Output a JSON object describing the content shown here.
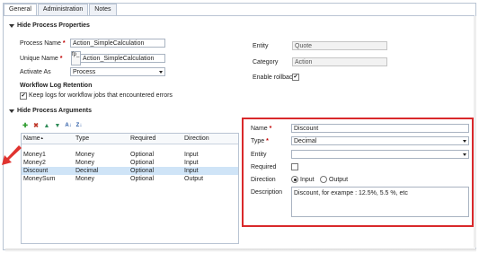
{
  "tabs": [
    "General",
    "Administration",
    "Notes"
  ],
  "process": {
    "section_title": "Hide Process Properties",
    "process_name_label": "Process Name",
    "process_name_value": "Action_SimpleCalculation",
    "unique_name_label": "Unique Name",
    "unique_name_prefix": "fp_",
    "unique_name_value": "Action_SimpleCalculation",
    "activate_as_label": "Activate As",
    "activate_as_value": "Process",
    "entity_label": "Entity",
    "entity_value": "Quote",
    "category_label": "Category",
    "category_value": "Action",
    "rollback_label": "Enable rollback",
    "rollback_checked": true,
    "log_title": "Workflow Log Retention",
    "log_label": "Keep logs for workflow jobs that encountered errors",
    "log_checked": true
  },
  "arguments": {
    "section_title": "Hide Process Arguments",
    "columns": [
      "Name",
      "Type",
      "Required",
      "Direction"
    ],
    "sort_indicator": "▲",
    "rows": [
      {
        "name": "Money1",
        "type": "Money",
        "required": "Optional",
        "direction": "Input"
      },
      {
        "name": "Money2",
        "type": "Money",
        "required": "Optional",
        "direction": "Input"
      },
      {
        "name": "Discount",
        "type": "Decimal",
        "required": "Optional",
        "direction": "Input"
      },
      {
        "name": "MoneySum",
        "type": "Money",
        "required": "Optional",
        "direction": "Output"
      }
    ],
    "selected_row": 2
  },
  "detail": {
    "name_label": "Name",
    "name_value": "Discount",
    "type_label": "Type",
    "type_value": "Decimal",
    "entity_label": "Entity",
    "entity_value": "",
    "required_label": "Required",
    "direction_label": "Direction",
    "direction_input": "Input",
    "direction_output": "Output",
    "description_label": "Description",
    "description_value": "Discount, for exampe : 12.5%, 5.5 %, etc"
  },
  "colors": {
    "highlight_border": "#d9292b",
    "selected_row": "#cfe4f7",
    "arrow": "#e0332f"
  },
  "icons": [
    "add-icon",
    "delete-icon",
    "move-up-icon",
    "move-down-icon",
    "sort-ascending-icon",
    "sort-descending-icon",
    "annotation-arrow-icon"
  ]
}
